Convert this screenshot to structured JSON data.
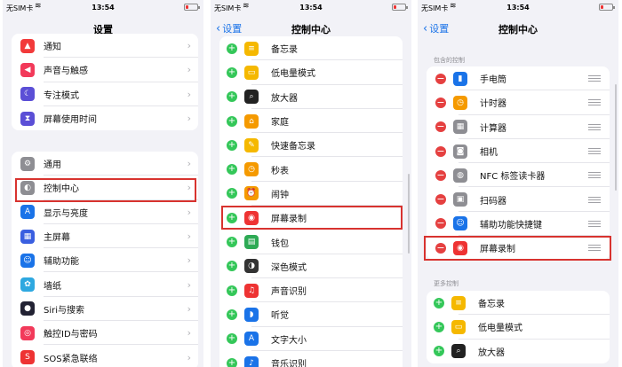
{
  "status": {
    "carrier": "无SIM卡",
    "time": "13:54"
  },
  "panel1": {
    "title": "设置",
    "group1": [
      {
        "label": "通知",
        "icon": "bell-icon",
        "color": "#f23a3a",
        "glyph": "▲"
      },
      {
        "label": "声音与触感",
        "icon": "speaker-icon",
        "color": "#f23a5a",
        "glyph": "◀"
      },
      {
        "label": "专注模式",
        "icon": "moon-icon",
        "color": "#5b4fd6",
        "glyph": "☾"
      },
      {
        "label": "屏幕使用时间",
        "icon": "hourglass-icon",
        "color": "#5b4fd6",
        "glyph": "⧗"
      }
    ],
    "group2": [
      {
        "label": "通用",
        "icon": "gear-icon",
        "color": "#8e8e93",
        "glyph": "⚙"
      },
      {
        "label": "控制中心",
        "icon": "toggles-icon",
        "color": "#8e8e93",
        "glyph": "◐"
      },
      {
        "label": "显示与亮度",
        "icon": "text-size-icon",
        "color": "#1a73e8",
        "glyph": "A"
      },
      {
        "label": "主屏幕",
        "icon": "grid-icon",
        "color": "#3a5fe0",
        "glyph": "▦"
      },
      {
        "label": "辅助功能",
        "icon": "accessibility-icon",
        "color": "#1a73e8",
        "glyph": "☺"
      },
      {
        "label": "墙纸",
        "icon": "flower-icon",
        "color": "#2ea8e0",
        "glyph": "✿"
      },
      {
        "label": "Siri与搜索",
        "icon": "siri-icon",
        "color": "#222233",
        "glyph": "●"
      },
      {
        "label": "触控ID与密码",
        "icon": "fingerprint-icon",
        "color": "#f23a5a",
        "glyph": "◎"
      },
      {
        "label": "SOS紧急联络",
        "icon": "sos-icon",
        "color": "#e33",
        "glyph": "S"
      }
    ]
  },
  "panel2": {
    "back": "设置",
    "title": "控制中心",
    "items": [
      {
        "label": "备忘录",
        "icon": "notes-icon",
        "color": "#f5b800",
        "glyph": "≡"
      },
      {
        "label": "低电量模式",
        "icon": "battery-icon",
        "color": "#f5b800",
        "glyph": "▭"
      },
      {
        "label": "放大器",
        "icon": "magnifier-icon",
        "color": "#222",
        "glyph": "⌕"
      },
      {
        "label": "家庭",
        "icon": "home-icon",
        "color": "#f59a00",
        "glyph": "⌂"
      },
      {
        "label": "快速备忘录",
        "icon": "quick-note-icon",
        "color": "#f5b800",
        "glyph": "✎"
      },
      {
        "label": "秒表",
        "icon": "stopwatch-icon",
        "color": "#f59a00",
        "glyph": "◷"
      },
      {
        "label": "闹钟",
        "icon": "alarm-icon",
        "color": "#f59a00",
        "glyph": "⏰"
      },
      {
        "label": "屏幕录制",
        "icon": "record-icon",
        "color": "#e33",
        "glyph": "◉"
      },
      {
        "label": "钱包",
        "icon": "wallet-icon",
        "color": "#2eaa55",
        "glyph": "▤"
      },
      {
        "label": "深色模式",
        "icon": "dark-mode-icon",
        "color": "#333",
        "glyph": "◑"
      },
      {
        "label": "声音识别",
        "icon": "waveform-icon",
        "color": "#e33",
        "glyph": "♫"
      },
      {
        "label": "听觉",
        "icon": "ear-icon",
        "color": "#1a73e8",
        "glyph": "◗"
      },
      {
        "label": "文字大小",
        "icon": "text-size-icon",
        "color": "#1a73e8",
        "glyph": "A"
      },
      {
        "label": "音乐识别",
        "icon": "shazam-icon",
        "color": "#1a73e8",
        "glyph": "♪"
      }
    ]
  },
  "panel3": {
    "back": "设置",
    "title": "控制中心",
    "included_label": "包含的控制",
    "included": [
      {
        "label": "手电筒",
        "icon": "flashlight-icon",
        "color": "#1a73e8",
        "glyph": "▮"
      },
      {
        "label": "计时器",
        "icon": "timer-icon",
        "color": "#f59a00",
        "glyph": "◷"
      },
      {
        "label": "计算器",
        "icon": "calculator-icon",
        "color": "#8e8e93",
        "glyph": "▦"
      },
      {
        "label": "相机",
        "icon": "camera-icon",
        "color": "#8e8e93",
        "glyph": "◙"
      },
      {
        "label": "NFC 标签读卡器",
        "icon": "nfc-icon",
        "color": "#8e8e93",
        "glyph": "◍"
      },
      {
        "label": "扫码器",
        "icon": "qr-icon",
        "color": "#8e8e93",
        "glyph": "▣"
      },
      {
        "label": "辅助功能快捷键",
        "icon": "accessibility-icon",
        "color": "#1a73e8",
        "glyph": "☺"
      },
      {
        "label": "屏幕录制",
        "icon": "record-icon",
        "color": "#e33",
        "glyph": "◉"
      }
    ],
    "more_label": "更多控制",
    "more": [
      {
        "label": "备忘录",
        "icon": "notes-icon",
        "color": "#f5b800",
        "glyph": "≡"
      },
      {
        "label": "低电量模式",
        "icon": "battery-icon",
        "color": "#f5b800",
        "glyph": "▭"
      },
      {
        "label": "放大器",
        "icon": "magnifier-icon",
        "color": "#222",
        "glyph": "⌕"
      }
    ]
  }
}
